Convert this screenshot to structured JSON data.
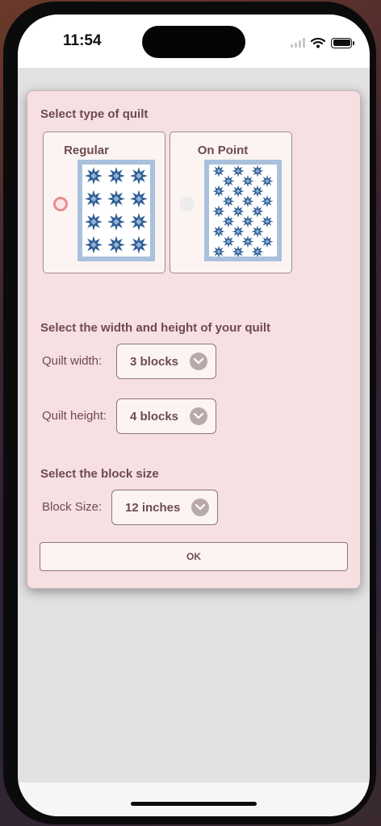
{
  "status": {
    "time": "11:54"
  },
  "dialog": {
    "quilt_type_title": "Select type of quilt",
    "options": [
      {
        "label": "Regular",
        "selected": true
      },
      {
        "label": "On Point",
        "selected": false
      }
    ],
    "size_title": "Select the width and height of your quilt",
    "width_label": "Quilt width:",
    "width_value": "3 blocks",
    "height_label": "Quilt height:",
    "height_value": "4 blocks",
    "block_title": "Select the block size",
    "block_label": "Block Size:",
    "block_value": "12 inches",
    "ok_label": "OK"
  },
  "colors": {
    "dialog_bg": "#f7e0e2",
    "text": "#6e4a51",
    "quilt_border": "#a9c1dc",
    "star_dark": "#2f5d93",
    "star_light": "#8fb2d8",
    "radio_selected": "#e88c95"
  },
  "icons": [
    "wifi-icon",
    "battery-icon",
    "signal-icon",
    "chevron-down-icon",
    "star-block-icon"
  ]
}
